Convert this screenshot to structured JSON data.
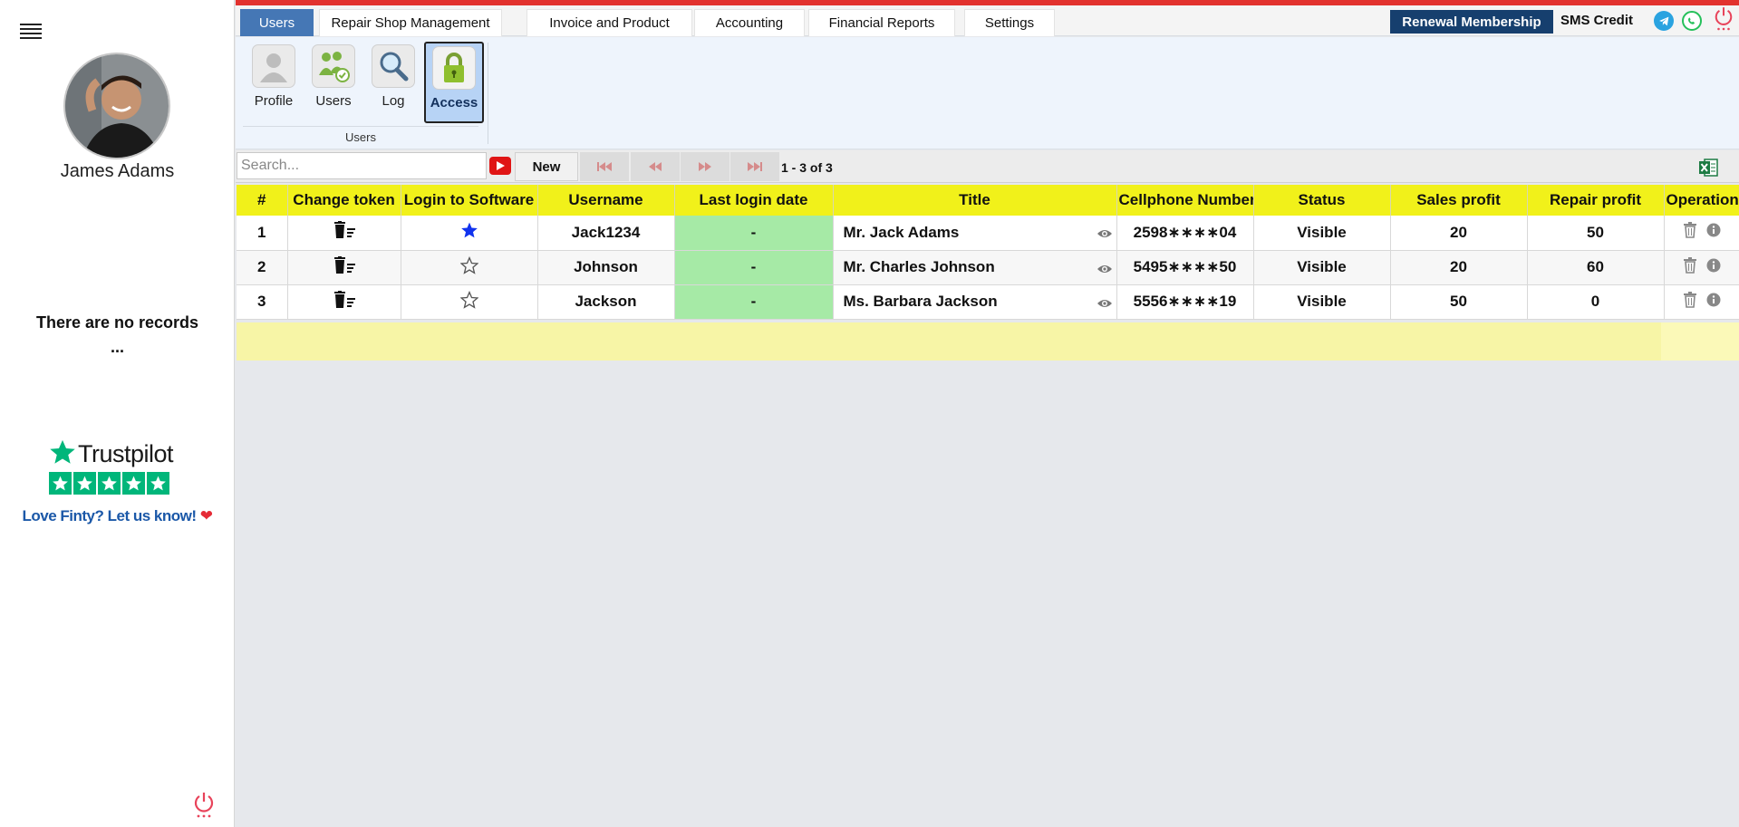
{
  "sidebar": {
    "user_name": "James Adams",
    "empty_message_line1": "There are no records",
    "empty_message_line2": "...",
    "trustpilot_word": "Trustpilot",
    "love_text": "Love Finty? Let us know!"
  },
  "nav": {
    "tabs": [
      {
        "label": "Users",
        "active": true
      },
      {
        "label": "Repair Shop Management"
      },
      {
        "label": "Invoice and Product"
      },
      {
        "label": "Accounting"
      },
      {
        "label": "Financial Reports"
      },
      {
        "label": "Settings"
      }
    ],
    "renewal_label": "Renewal Membership",
    "sms_label": "SMS Credit"
  },
  "ribbon": {
    "items": [
      {
        "label": "Profile"
      },
      {
        "label": "Users"
      },
      {
        "label": "Log"
      },
      {
        "label": "Access",
        "active": true
      }
    ],
    "group_label": "Users"
  },
  "toolbar": {
    "search_placeholder": "Search...",
    "new_label": "New",
    "page_info": "1 - 3 of 3"
  },
  "table": {
    "headers": [
      "#",
      "Change token",
      "Login to Software",
      "Username",
      "Last login date",
      "Title",
      "Cellphone Number",
      "Status",
      "Sales profit",
      "Repair profit",
      "Operation"
    ],
    "rows": [
      {
        "num": "1",
        "login_starred": true,
        "username": "Jack1234",
        "last_login": "-",
        "title": "Mr. Jack Adams",
        "phone": "2598∗∗∗∗04",
        "status": "Visible",
        "sales_profit": "20",
        "repair_profit": "50"
      },
      {
        "num": "2",
        "login_starred": false,
        "username": "Johnson",
        "last_login": "-",
        "title": "Mr. Charles Johnson",
        "phone": "5495∗∗∗∗50",
        "status": "Visible",
        "sales_profit": "20",
        "repair_profit": "60"
      },
      {
        "num": "3",
        "login_starred": false,
        "username": "Jackson",
        "last_login": "-",
        "title": "Ms. Barbara Jackson",
        "phone": "5556∗∗∗∗19",
        "status": "Visible",
        "sales_profit": "50",
        "repair_profit": "0"
      }
    ]
  },
  "colors": {
    "accent": "#4577b5",
    "header_yellow": "#f1f11a",
    "renew_bg": "#163f6e",
    "top_red": "#e2322e",
    "login_green": "#a6eaa6"
  },
  "icons": {
    "change_token": "trash-list-icon",
    "login_starred": "star-filled-icon",
    "login_unstarred": "star-outline-icon",
    "title_view": "eye-icon",
    "operation": [
      "trash-icon",
      "info-icon"
    ]
  }
}
